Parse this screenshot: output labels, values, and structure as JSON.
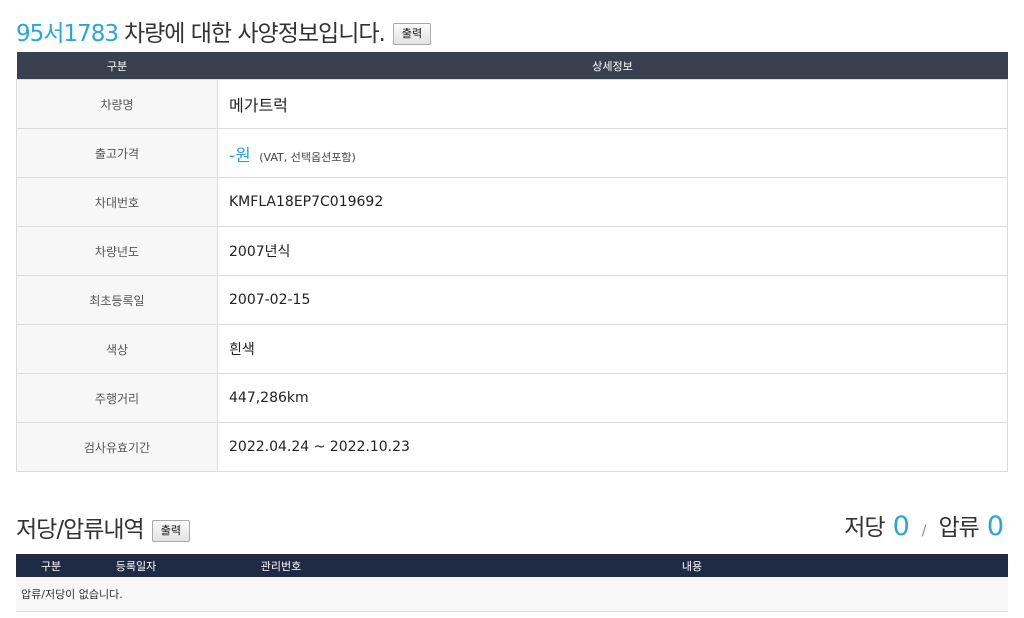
{
  "header": {
    "plate": "95서1783",
    "title_suffix": "차량에 대한 사양정보입니다.",
    "print_label": "출력"
  },
  "spec_table": {
    "headers": [
      "구분",
      "상세정보"
    ],
    "rows": [
      {
        "label": "차량명",
        "value": "메가트럭"
      },
      {
        "label": "출고가격",
        "value_prefix": "-원",
        "value_note": "(VAT, 선택옵션포함)"
      },
      {
        "label": "차대번호",
        "value": "KMFLA18EP7C019692"
      },
      {
        "label": "차량년도",
        "value": "2007년식"
      },
      {
        "label": "최초등록일",
        "value": "2007-02-15"
      },
      {
        "label": "색상",
        "value": "흰색"
      },
      {
        "label": "주행거리",
        "value": "447,286km"
      },
      {
        "label": "검사유효기간",
        "value": "2022.04.24 ~ 2022.10.23"
      }
    ]
  },
  "lien_section": {
    "title": "저당/압류내역",
    "print_label": "출력",
    "mortgage_label": "저당",
    "mortgage_count": "0",
    "separator": "/",
    "seizure_label": "압류",
    "seizure_count": "0",
    "headers": [
      "구분",
      "등록일자",
      "관리번호",
      "내용"
    ],
    "empty_message": "압류/저당이 없습니다."
  },
  "colors": {
    "accent": "#2aa6d6",
    "spec_header_bg": "#394150",
    "lien_header_bg": "#1f2a44",
    "label_cell_bg": "#f7f7f7"
  }
}
